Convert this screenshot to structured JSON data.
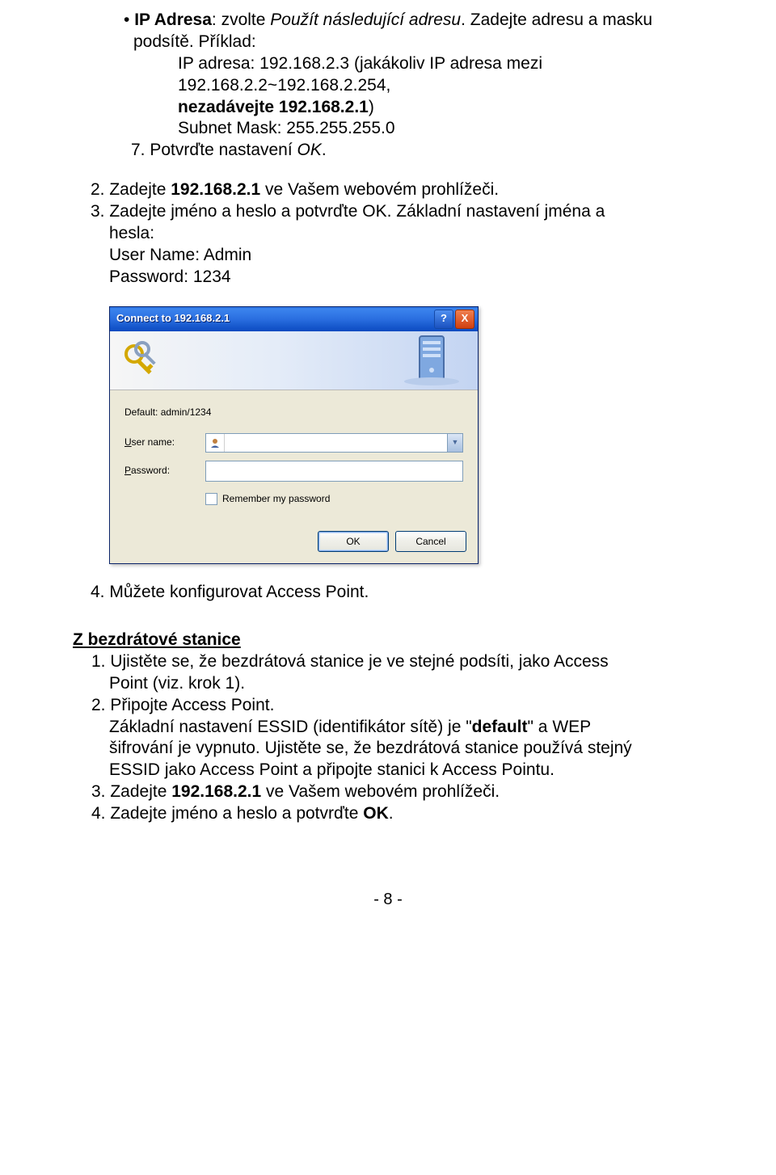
{
  "para1": {
    "bullet_label": "IP Adresa",
    "bullet_rest": ": zvolte ",
    "bullet_italic": "Použít následující adresu",
    "bullet_tail": ". Zadejte adresu a masku podsítě. Příklad:",
    "line2": "IP adresa: 192.168.2.3 (jakákoliv IP adresa mezi 192.168.2.2~192.168.2.254,",
    "line3_bold": "nezadávejte 192.168.2.1",
    "line3_tail": ")",
    "line4": "Subnet Mask: 255.255.255.0",
    "item7_a": "7. Potvrďte nastavení ",
    "item7_i": "OK",
    "item7_b": "."
  },
  "step2": {
    "pre": "2. Zadejte  ",
    "bold": "192.168.2.1",
    "post": "  ve Vašem webovém prohlížeči."
  },
  "step3": {
    "line1": "3. Zadejte jméno a heslo a potvrďte OK. Základní nastavení jména a",
    "line2": "hesla:",
    "line3": "User Name: Admin",
    "line4": "Password: 1234"
  },
  "dialog": {
    "title": "Connect to 192.168.2.1",
    "help_icon": "?",
    "close_icon": "X",
    "default_hint": "Default: admin/1234",
    "user_label_pre": "",
    "user_label_u": "U",
    "user_label_post": "ser name:",
    "pw_label_pre": "",
    "pw_label_u": "P",
    "pw_label_post": "assword:",
    "remember_pre": "",
    "remember_u": "R",
    "remember_post": "emember my password",
    "ok": "OK",
    "cancel": "Cancel",
    "user_value": ""
  },
  "step4": "4. Můžete konfigurovat Access Point.",
  "section_title": "Z bezdrátové stanice",
  "w1": {
    "a": "1. Ujistěte se, že bezdrátová stanice je ve stejné podsíti, jako Access",
    "b": "Point (viz. krok 1)."
  },
  "w2": {
    "a": "2. Připojte Access Point.",
    "b1": "Základní nastavení ESSID (identifikátor sítě) je \"",
    "b1_bold": "default",
    "b1_tail": "\" a  WEP",
    "c": "šifrování je vypnuto. Ujistěte se, že bezdrátová stanice používá stejný",
    "d": "ESSID jako Access Point a připojte stanici k Access Pointu."
  },
  "w3": {
    "pre": "3.  Zadejte  ",
    "bold": "192.168.2.1",
    "post": "  ve Vašem webovém prohlížeči."
  },
  "w4": {
    "pre": "4. Zadejte jméno a heslo a potvrďte  ",
    "bold": "OK",
    "post": "."
  },
  "footer": "- 8 -"
}
